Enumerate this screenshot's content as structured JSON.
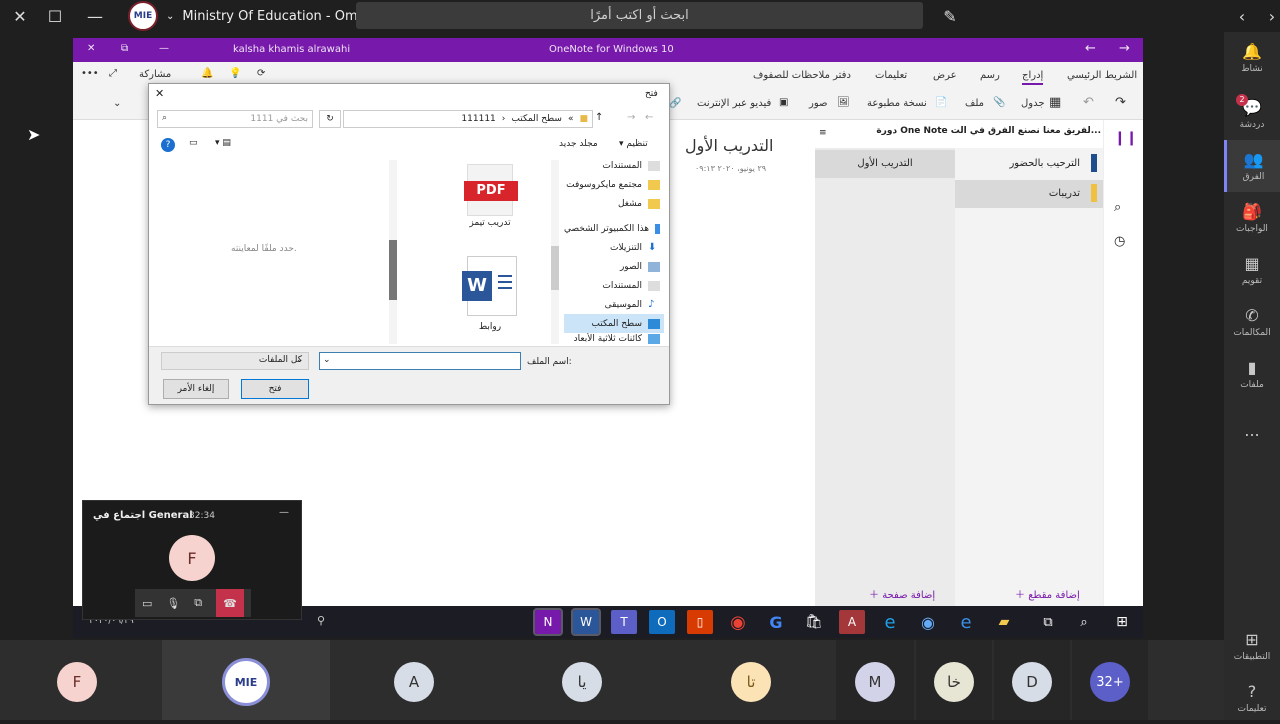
{
  "teams": {
    "org_name": "Ministry Of Education - Oman",
    "org_logo_text": "MIE",
    "search_placeholder": "ابحث أو اكتب أمرًا",
    "rail": [
      {
        "label": "نشاط",
        "icon": "bell-icon"
      },
      {
        "label": "دردشة",
        "icon": "chat-icon",
        "badge": "2"
      },
      {
        "label": "الفرق",
        "icon": "teams-icon"
      },
      {
        "label": "الواجبات",
        "icon": "assignments-icon"
      },
      {
        "label": "تقويم",
        "icon": "calendar-icon"
      },
      {
        "label": "المكالمات",
        "icon": "phone-icon"
      },
      {
        "label": "ملفات",
        "icon": "files-icon"
      },
      {
        "label": "...",
        "icon": "more-icon"
      }
    ],
    "rail_bottom": [
      {
        "label": "التطبيقات",
        "icon": "apps-icon"
      },
      {
        "label": "تعليمات",
        "icon": "help-icon"
      }
    ]
  },
  "onenote": {
    "user": "kalsha khamis alrawahi",
    "app_title": "OneNote for Windows 10",
    "tabs": [
      "الشريط الرئيسي",
      "إدراج",
      "رسم",
      "عرض",
      "تعليمات",
      "دفتر ملاحظات للصفوف"
    ],
    "active_tab": "إدراج",
    "share_label": "مشاركة",
    "commands": [
      "جدول",
      "ملف",
      "نسخة مطبوعة",
      "صور",
      "فيديو عبر الإنترنت"
    ],
    "notebook_title": "دورة One Note لفريق معنا نصنع الفرق في الت...",
    "sections": [
      "الترحيب بالحضور",
      "تدريبات"
    ],
    "pages": [
      "التدريب الأول"
    ],
    "page_title": "التدريب الأول",
    "page_date": "٢٩ يونيو، ٢٠٢٠   ٠٩:١٣",
    "add_section": "إضافة مقطع",
    "add_page": "إضافة صفحة"
  },
  "dialog": {
    "title": "فتح",
    "path": [
      "سطح المكتب",
      "111111"
    ],
    "search_placeholder": "بحث في 1111",
    "organize": "تنظيم",
    "new_folder": "مجلد جديد",
    "nav_items": [
      "المستندات",
      "مجتمع مايكروسوفت",
      "مشغل",
      "هذا الكمبيوتر الشخصي",
      "التنزيلات",
      "الصور",
      "المستندات",
      "الموسيقى",
      "سطح المكتب",
      "كائنات ثلاثية الأبعاد"
    ],
    "nav_selected": "سطح المكتب",
    "files": [
      {
        "name": "تدريب تيمز",
        "type": "PDF"
      },
      {
        "name": "روابط",
        "type": "W"
      }
    ],
    "preview_msg": "حدد ملفًا لمعاينته.",
    "filename_label": "اسم الملف:",
    "filename_value": "",
    "filetype": "كل الملفات",
    "open_btn": "فتح",
    "cancel_btn": "إلغاء الأمر"
  },
  "taskbar": {
    "date": "٢٠٢٠/٠٦/٢٩"
  },
  "call": {
    "title": "اجتماع في General",
    "timer": "32:34",
    "avatar": "F"
  },
  "participants": [
    {
      "initials": "F",
      "color": "#f6d3cf",
      "text": "#6b2d2a"
    },
    {
      "initials": "MIE",
      "logo": true
    },
    {
      "initials": "A",
      "color": "#d6dde6",
      "text": "#333"
    },
    {
      "initials": "يا",
      "color": "#d6dde6",
      "text": "#333"
    },
    {
      "initials": "تا",
      "color": "#fbe3b6",
      "text": "#7a5a17"
    },
    {
      "initials": "M",
      "color": "#d2d3e8",
      "text": "#333"
    },
    {
      "initials": "خا",
      "color": "#e7e6d5",
      "text": "#333"
    },
    {
      "initials": "D",
      "color": "#d6dde6",
      "text": "#333"
    },
    {
      "initials": "32+",
      "color": "#5b5fc7",
      "text": "#fff"
    }
  ]
}
